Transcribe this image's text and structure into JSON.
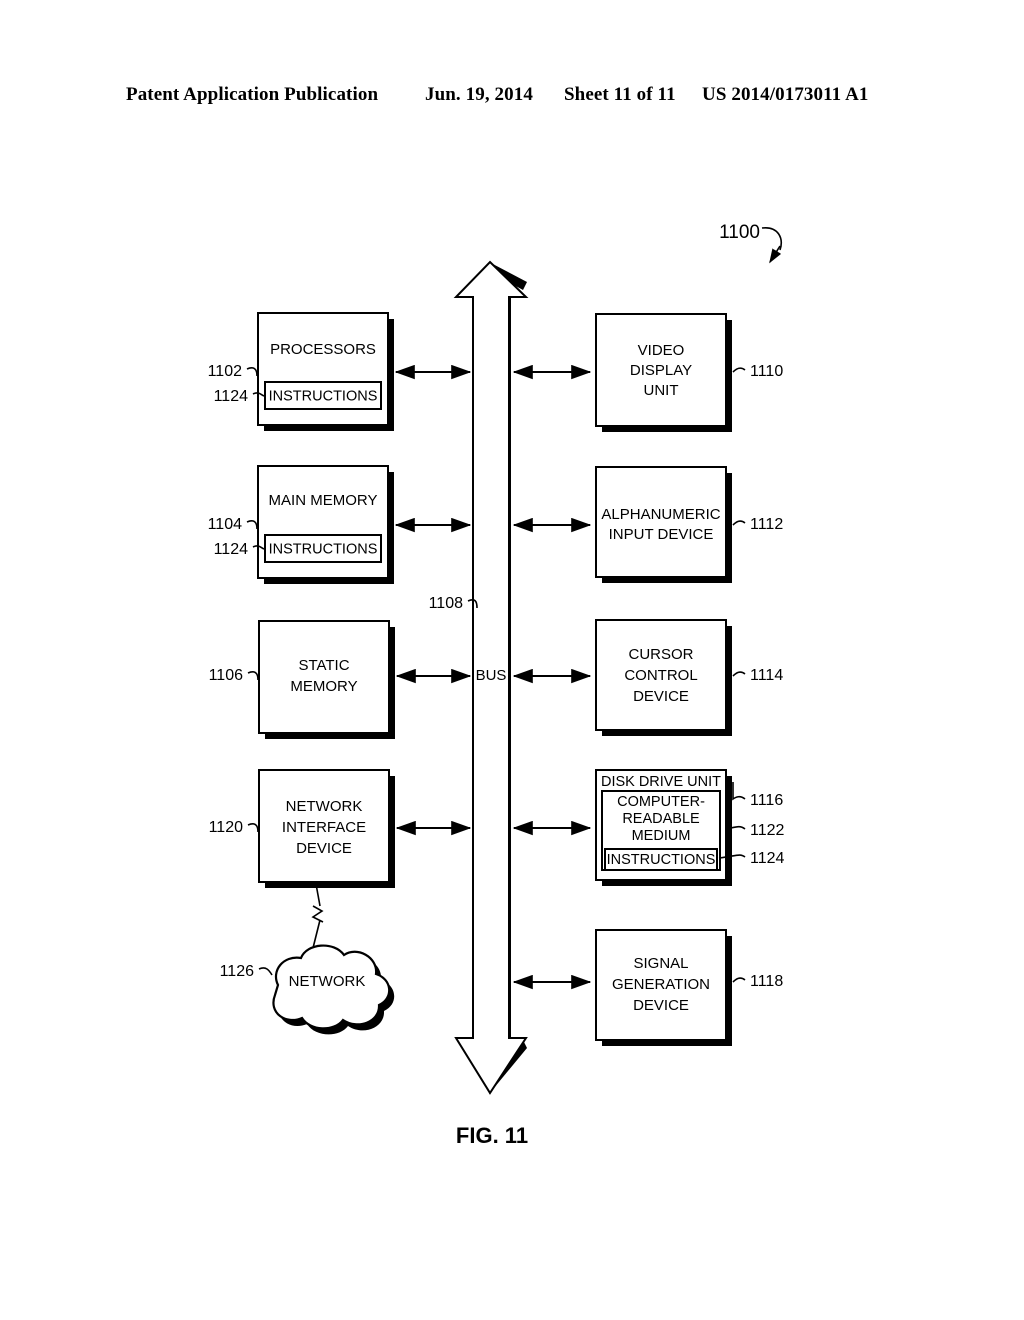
{
  "header": {
    "publication": "Patent Application Publication",
    "date": "Jun. 19, 2014",
    "sheet": "Sheet 11 of 11",
    "patent_number": "US 2014/0173011 A1"
  },
  "figure": {
    "caption": "FIG. 11",
    "system_ref": "1100",
    "bus_label": "BUS",
    "bus_ref": "1108",
    "blocks": [
      {
        "id": "processors",
        "ref": "1102",
        "lines": [
          "PROCESSORS"
        ],
        "sub": {
          "id": "processors-instructions",
          "ref": "1124",
          "label": "INSTRUCTIONS"
        }
      },
      {
        "id": "main-memory",
        "ref": "1104",
        "lines": [
          "MAIN MEMORY"
        ],
        "sub": {
          "id": "main-memory-instructions",
          "ref": "1124",
          "label": "INSTRUCTIONS"
        }
      },
      {
        "id": "static-memory",
        "ref": "1106",
        "lines": [
          "STATIC",
          "MEMORY"
        ]
      },
      {
        "id": "network-interface-device",
        "ref": "1120",
        "lines": [
          "NETWORK",
          "INTERFACE",
          "DEVICE"
        ]
      },
      {
        "id": "video-display-unit",
        "ref": "1110",
        "lines": [
          "VIDEO",
          "DISPLAY",
          "UNIT"
        ]
      },
      {
        "id": "alphanumeric-input-device",
        "ref": "1112",
        "lines": [
          "ALPHANUMERIC",
          "INPUT DEVICE"
        ]
      },
      {
        "id": "cursor-control-device",
        "ref": "1114",
        "lines": [
          "CURSOR",
          "CONTROL",
          "DEVICE"
        ]
      },
      {
        "id": "disk-drive-unit",
        "ref": "1116",
        "lines": [
          "DISK DRIVE UNIT"
        ],
        "medium": {
          "id": "computer-readable-medium",
          "ref": "1122",
          "lines": [
            "COMPUTER-",
            "READABLE",
            "MEDIUM"
          ]
        },
        "sub": {
          "id": "disk-instructions",
          "ref": "1124",
          "label": "INSTRUCTIONS"
        }
      },
      {
        "id": "signal-generation-device",
        "ref": "1118",
        "lines": [
          "SIGNAL",
          "GENERATION",
          "DEVICE"
        ]
      }
    ],
    "network_cloud": {
      "id": "network-cloud",
      "ref": "1126",
      "label": "NETWORK"
    }
  },
  "colors": {
    "ink": "#000000",
    "paper": "#ffffff"
  }
}
